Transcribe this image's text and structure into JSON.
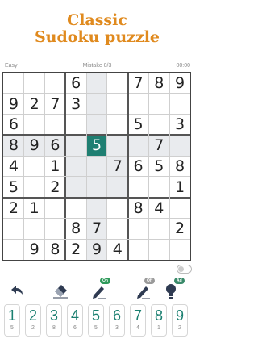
{
  "header": {
    "title_line1": "Classic",
    "title_line2": "Sudoku puzzle"
  },
  "status": {
    "difficulty": "Easy",
    "mistakes": "Mistake 0/3",
    "timer": "00:00"
  },
  "board": {
    "rows": [
      [
        "",
        "",
        "",
        "6",
        "",
        "",
        "7",
        "8",
        "9"
      ],
      [
        "9",
        "2",
        "7",
        "3",
        "",
        "",
        "",
        "",
        ""
      ],
      [
        "6",
        "",
        "",
        "",
        "",
        "",
        "5",
        "",
        "3"
      ],
      [
        "8",
        "9",
        "6",
        "",
        "5",
        "",
        "",
        "7",
        ""
      ],
      [
        "4",
        "",
        "1",
        "",
        "",
        "7",
        "6",
        "5",
        "8"
      ],
      [
        "5",
        "",
        "2",
        "",
        "",
        "",
        "",
        "",
        "1"
      ],
      [
        "2",
        "1",
        "",
        "",
        "",
        "",
        "8",
        "4",
        ""
      ],
      [
        "",
        "",
        "",
        "8",
        "7",
        "",
        "",
        "",
        "2"
      ],
      [
        "",
        "9",
        "8",
        "2",
        "9",
        "4",
        "",
        "",
        ""
      ]
    ],
    "selected": {
      "row": 3,
      "col": 4
    }
  },
  "tools": [
    {
      "icon": "undo-icon",
      "badge": ""
    },
    {
      "icon": "eraser-icon",
      "badge": ""
    },
    {
      "icon": "pencil-notes-icon",
      "badge": "On"
    },
    {
      "icon": "quick-pencil-icon",
      "badge": "Off"
    },
    {
      "icon": "hint-bulb-icon",
      "badge": "Ad"
    }
  ],
  "numpad": [
    {
      "digit": "1",
      "count": "5"
    },
    {
      "digit": "2",
      "count": "2"
    },
    {
      "digit": "3",
      "count": "8"
    },
    {
      "digit": "4",
      "count": "6"
    },
    {
      "digit": "5",
      "count": "5"
    },
    {
      "digit": "6",
      "count": "3"
    },
    {
      "digit": "7",
      "count": "4"
    },
    {
      "digit": "8",
      "count": "1"
    },
    {
      "digit": "9",
      "count": "2"
    }
  ],
  "colors": {
    "accent": "#1f7f72",
    "title": "#e08a1e",
    "badge_on": "#2e9a5a",
    "badge_off": "#9a9a9a",
    "badge_ad": "#3a8a6a"
  }
}
